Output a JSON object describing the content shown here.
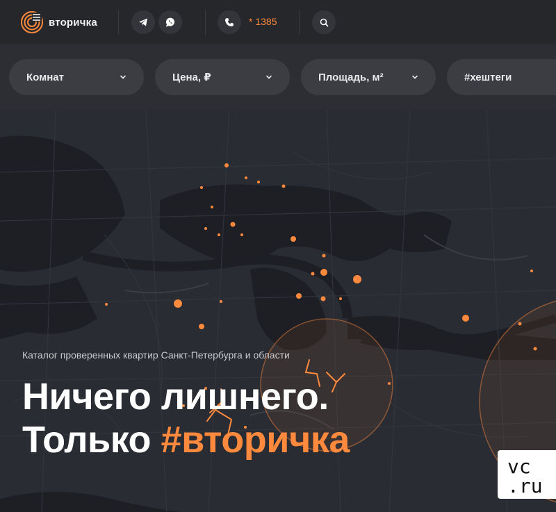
{
  "header": {
    "logo_text": "вторичка",
    "telegram_icon": "telegram-icon",
    "whatsapp_icon": "whatsapp-icon",
    "phone_icon": "phone-icon",
    "phone_number": "* 1385",
    "search_icon": "search-icon"
  },
  "filters": [
    {
      "label": "Комнат"
    },
    {
      "label": "Цена, ₽"
    },
    {
      "label": "Площадь, м²"
    },
    {
      "label": "#хештеги"
    }
  ],
  "hero": {
    "subtitle": "Каталог проверенных квартир Санкт-Петербурга и области",
    "headline_line1": "Ничего лишнего.",
    "headline_line2_prefix": "Только ",
    "headline_line2_accent": "#вторичка"
  },
  "watermark": {
    "line1": "vc",
    "line2": ".ru"
  },
  "colors": {
    "accent": "#ff8a3d",
    "background": "#222327",
    "pill": "#3c3d43"
  }
}
